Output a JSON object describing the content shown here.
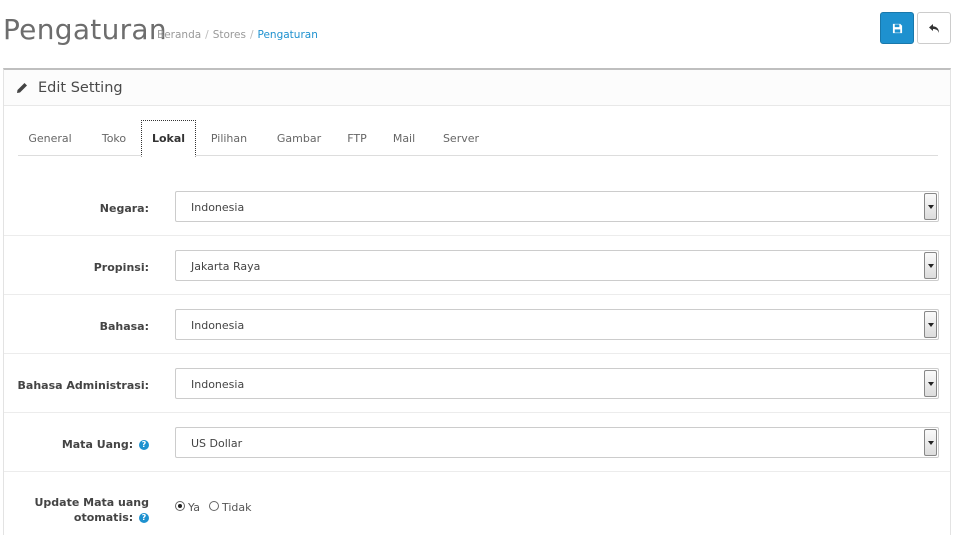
{
  "header": {
    "title": "Pengaturan",
    "breadcrumb": [
      "Beranda",
      "Stores",
      "Pengaturan"
    ]
  },
  "toolbar": {
    "save_icon": "save-icon",
    "back_icon": "reply-icon"
  },
  "panel": {
    "title": "Edit Setting",
    "title_icon": "pencil-icon"
  },
  "tabs": [
    "General",
    "Toko",
    "Lokal",
    "Pilihan",
    "Gambar",
    "FTP",
    "Mail",
    "Server"
  ],
  "active_tab": "Lokal",
  "form": {
    "negara": {
      "label": "Negara:",
      "value": "Indonesia"
    },
    "propinsi": {
      "label": "Propinsi:",
      "value": "Jakarta Raya"
    },
    "bahasa": {
      "label": "Bahasa:",
      "value": "Indonesia"
    },
    "bahasa_admin": {
      "label": "Bahasa Administrasi:",
      "value": "Indonesia"
    },
    "mata_uang": {
      "label": "Mata Uang:",
      "value": "US Dollar",
      "help": "?"
    },
    "update_mata_uang": {
      "label_line1": "Update Mata uang",
      "label_line2": "otomatis:",
      "help": "?",
      "options": [
        "Ya",
        "Tidak"
      ],
      "selected": "Ya"
    }
  },
  "colors": {
    "primary": "#1e91cf",
    "link": "#1e91cf"
  }
}
